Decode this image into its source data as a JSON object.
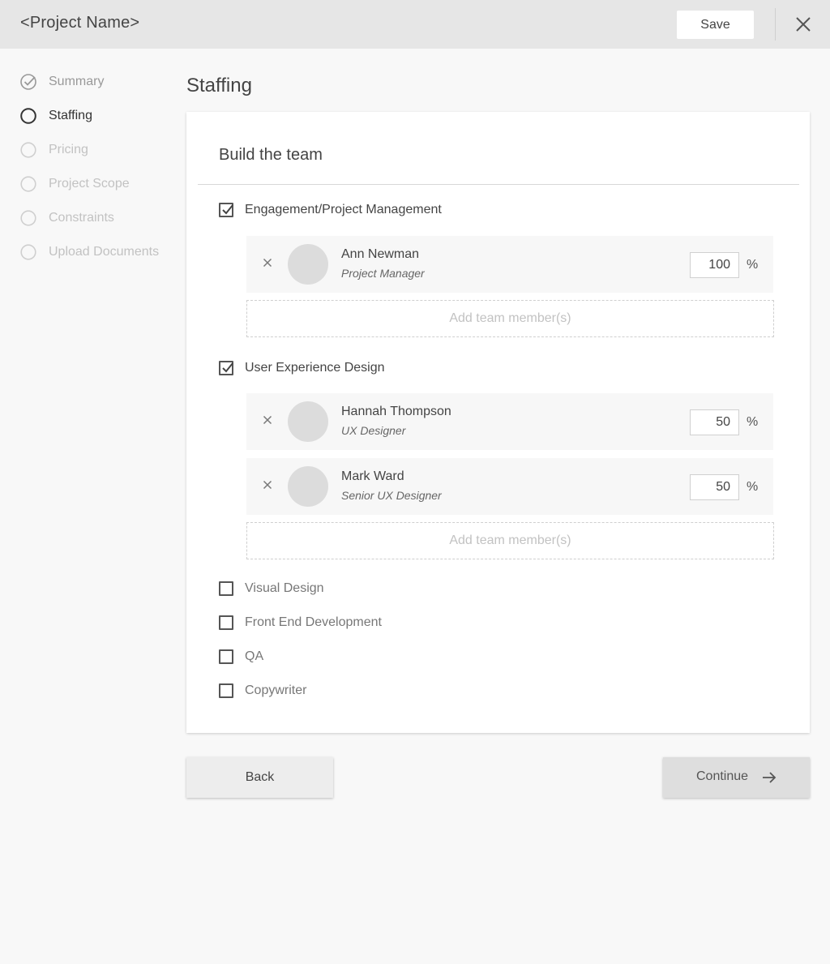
{
  "header": {
    "project_name": "<Project Name>",
    "save_label": "Save",
    "close_icon": "close-icon"
  },
  "steps": [
    {
      "label": "Summary",
      "state": "completed"
    },
    {
      "label": "Staffing",
      "state": "active"
    },
    {
      "label": "Pricing",
      "state": "upcoming"
    },
    {
      "label": "Project Scope",
      "state": "upcoming"
    },
    {
      "label": "Constraints",
      "state": "upcoming"
    },
    {
      "label": "Upload Documents",
      "state": "upcoming"
    }
  ],
  "page": {
    "heading": "Staffing"
  },
  "card": {
    "title": "Build the team",
    "add_member_label": "Add team member(s)",
    "percent_symbol": "%",
    "categories": [
      {
        "label": "Engagement/Project Management",
        "checked": true,
        "members": [
          {
            "name": "Ann Newman",
            "role": "Project Manager",
            "allocation": "100"
          }
        ]
      },
      {
        "label": "User Experience Design",
        "checked": true,
        "members": [
          {
            "name": "Hannah Thompson",
            "role": "UX Designer",
            "allocation": "50"
          },
          {
            "name": "Mark Ward",
            "role": "Senior UX Designer",
            "allocation": "50"
          }
        ]
      },
      {
        "label": "Visual Design",
        "checked": false,
        "members": []
      },
      {
        "label": "Front End Development",
        "checked": false,
        "members": []
      },
      {
        "label": "QA",
        "checked": false,
        "members": []
      },
      {
        "label": "Copywriter",
        "checked": false,
        "members": []
      }
    ]
  },
  "footer": {
    "back_label": "Back",
    "continue_label": "Continue"
  },
  "colors": {
    "header_bg": "#e6e6e6",
    "page_bg": "#f8f8f8",
    "card_bg": "#ffffff",
    "member_row_bg": "#f7f7f7",
    "avatar_placeholder": "#dcdcdc",
    "muted_text": "#c2c2c2"
  }
}
